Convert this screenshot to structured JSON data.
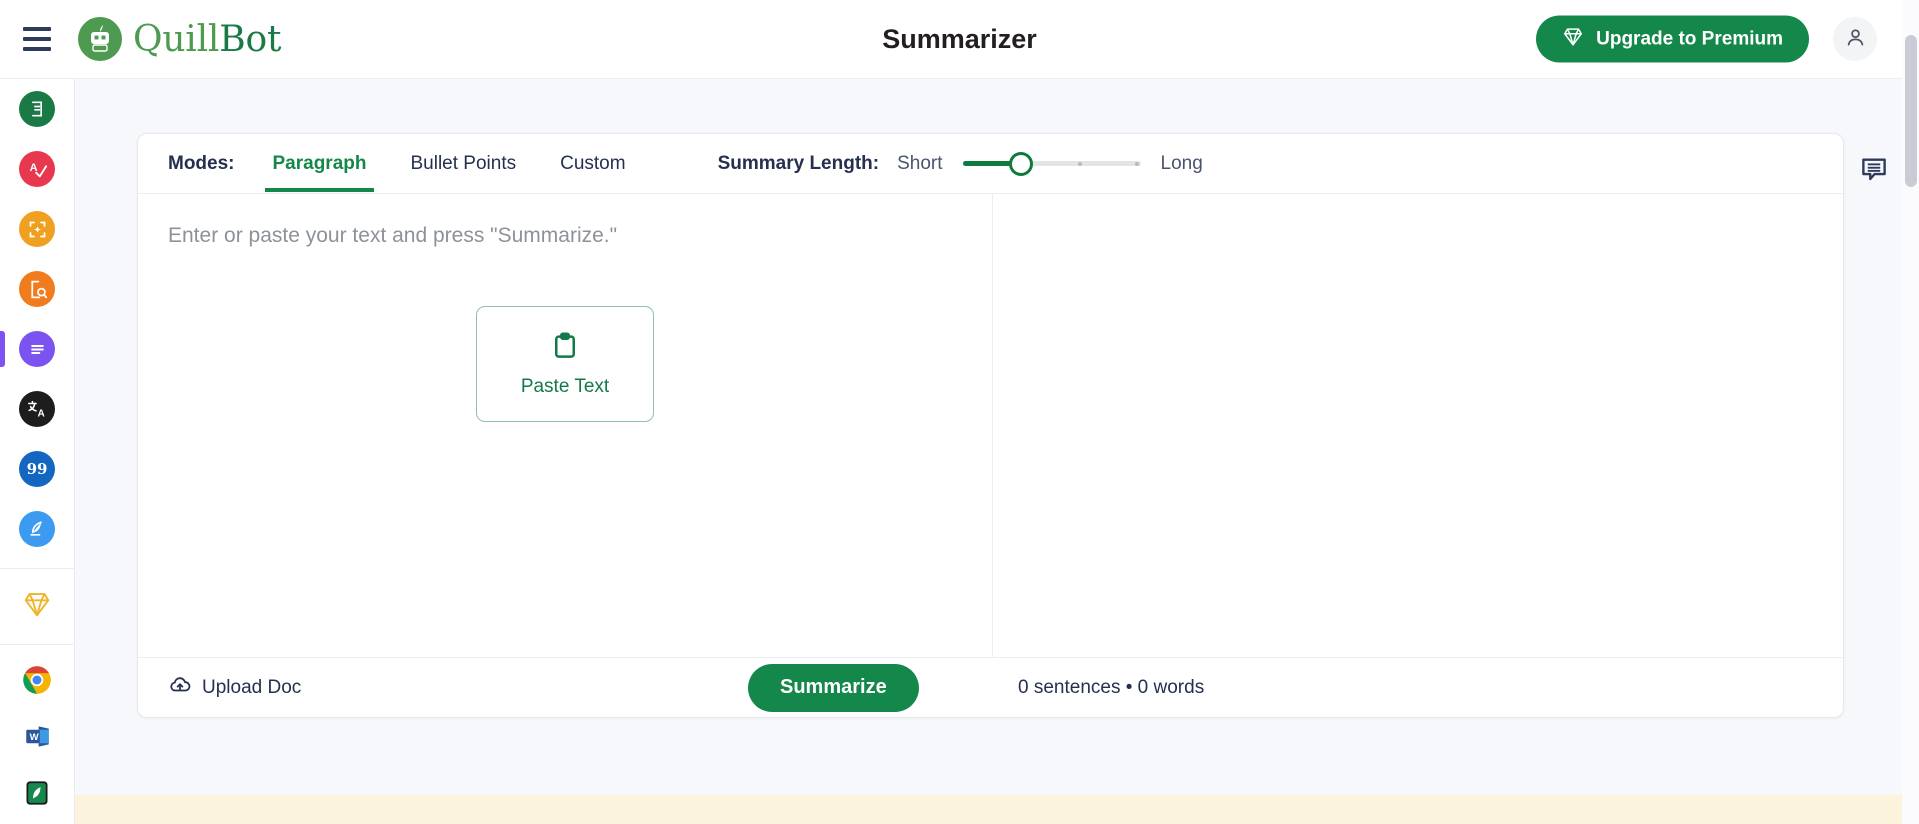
{
  "topbar": {
    "menu_icon": "hamburger-menu-icon",
    "brand": {
      "name_part1": "Quill",
      "name_part2": "Bot",
      "logo_icon": "quillbot-robot-logo"
    },
    "title": "Summarizer",
    "upgrade_button": {
      "label": "Upgrade to Premium",
      "icon": "diamond-icon",
      "color": "#14884a"
    },
    "avatar": {
      "icon": "person-icon"
    }
  },
  "sidebar": {
    "items": [
      {
        "name": "paraphraser",
        "icon": "paraphraser-icon",
        "color": "#1a7a45",
        "glyph": "☰",
        "active": false
      },
      {
        "name": "grammar-checker",
        "icon": "grammar-checker-icon",
        "color": "#e8384f",
        "glyph": "A",
        "active": false
      },
      {
        "name": "ai-detector",
        "icon": "ai-detector-icon",
        "color": "#f0a020",
        "glyph": "✦",
        "active": false
      },
      {
        "name": "plagiarism-checker",
        "icon": "plagiarism-checker-icon",
        "color": "#f07c1e",
        "glyph": "ⓛ",
        "active": false
      },
      {
        "name": "summarizer",
        "icon": "summarizer-icon",
        "color": "#7b53f0",
        "glyph": "≡",
        "active": true
      },
      {
        "name": "translator",
        "icon": "translator-icon",
        "color": "#1d1d1d",
        "glyph": "A",
        "active": false
      },
      {
        "name": "citation-generator",
        "icon": "citation-generator-icon",
        "color": "#1367c0",
        "glyph": "99",
        "active": false
      },
      {
        "name": "ai-writer",
        "icon": "ai-writer-icon",
        "color": "#3c9bf0",
        "glyph": "✎",
        "active": false
      }
    ],
    "premium": {
      "name": "premium",
      "icon": "diamond-premium-icon",
      "color": "#f0b429"
    },
    "apps": [
      {
        "name": "chrome-extension",
        "icon": "chrome-icon"
      },
      {
        "name": "word-addin",
        "icon": "microsoft-word-icon"
      },
      {
        "name": "quillbot-app",
        "icon": "quillbot-app-icon"
      }
    ]
  },
  "card": {
    "modes": {
      "label": "Modes:",
      "tabs": [
        {
          "label": "Paragraph",
          "active": true
        },
        {
          "label": "Bullet Points",
          "active": false
        },
        {
          "label": "Custom",
          "active": false
        }
      ]
    },
    "summary_length": {
      "label": "Summary Length:",
      "min_label": "Short",
      "max_label": "Long",
      "value": 2,
      "steps": 4,
      "fill_color": "#0f7a3d"
    },
    "editor": {
      "placeholder": "Enter or paste your text and press \"Summarize.\"",
      "paste_button": {
        "label": "Paste Text",
        "icon": "clipboard-icon"
      }
    },
    "footer": {
      "upload": {
        "label": "Upload Doc",
        "icon": "cloud-upload-icon"
      },
      "summarize_button": {
        "label": "Summarize"
      },
      "counts": "0 sentences • 0 words"
    }
  },
  "feedback": {
    "icon": "feedback-chat-icon"
  }
}
